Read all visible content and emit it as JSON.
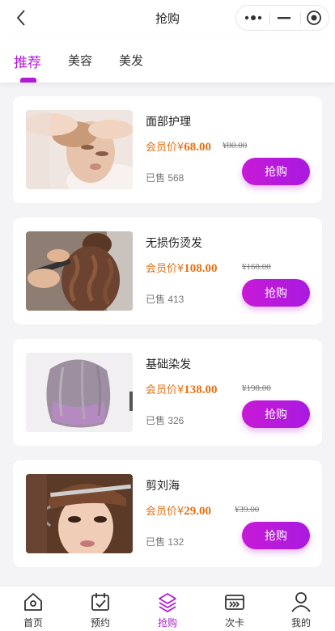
{
  "nav": {
    "title": "抢购"
  },
  "tabs": [
    {
      "label": "推荐",
      "active": true
    },
    {
      "label": "美容",
      "active": false
    },
    {
      "label": "美发",
      "active": false
    }
  ],
  "products": [
    {
      "name": "面部护理",
      "price_label": "会员价¥",
      "price": "68.00",
      "original": "¥80.00",
      "sold": "已售 568",
      "button": "抢购",
      "image": "facial-treatment-photo"
    },
    {
      "name": "无损伤烫发",
      "price_label": "会员价¥",
      "price": "108.00",
      "original": "¥168.00",
      "sold": "已售 413",
      "button": "抢购",
      "image": "hair-curling-photo"
    },
    {
      "name": "基础染发",
      "price_label": "会员价¥",
      "price": "138.00",
      "original": "¥198.00",
      "sold": "已售 326",
      "button": "抢购",
      "image": "dyed-hair-photo"
    },
    {
      "name": "剪刘海",
      "price_label": "会员价¥",
      "price": "29.00",
      "original": "¥39.00",
      "sold": "已售 132",
      "button": "抢购",
      "image": "bangs-cut-photo"
    }
  ],
  "tabbar": [
    {
      "label": "首页",
      "icon": "home-icon",
      "active": false
    },
    {
      "label": "预约",
      "icon": "calendar-icon",
      "active": false
    },
    {
      "label": "抢购",
      "icon": "layers-icon",
      "active": true
    },
    {
      "label": "次卡",
      "icon": "card-icon",
      "active": false
    },
    {
      "label": "我的",
      "icon": "user-icon",
      "active": false
    }
  ],
  "colors": {
    "accent": "#b21ad8",
    "price": "#e37114",
    "background": "#f4f4f6"
  }
}
